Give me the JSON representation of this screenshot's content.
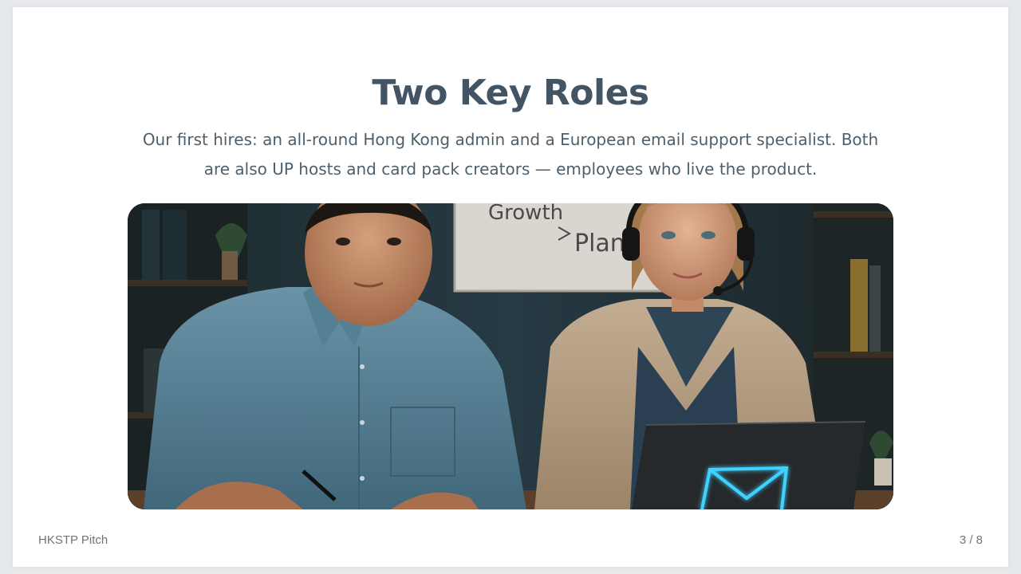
{
  "slide": {
    "title": "Two Key Roles",
    "subtitle": "Our first hires: an all-round Hong Kong admin and a European email support specialist. Both are also UP hosts and card pack creators — employees who live the product."
  },
  "hero_image": {
    "whiteboard_text_1": "Growth",
    "whiteboard_text_2": "Plan",
    "laptop_icon": "envelope-icon"
  },
  "footer": {
    "deck_name": "HKSTP Pitch",
    "page_indicator": "3 / 8"
  },
  "colors": {
    "title": "#435564",
    "text": "#4e5f6c",
    "footer": "#6e7479",
    "glow": "#3fd2ff"
  }
}
